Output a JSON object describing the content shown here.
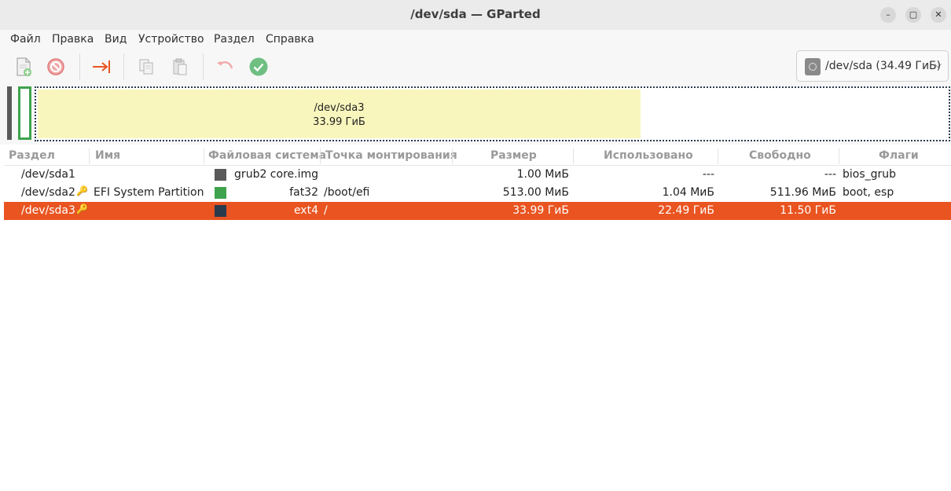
{
  "window": {
    "title": "/dev/sda — GParted",
    "buttons": {
      "minimize": "–",
      "maximize": "▢",
      "close": "✕"
    }
  },
  "menu": [
    "Файл",
    "Правка",
    "Вид",
    "Устройство",
    "Раздел",
    "Справка"
  ],
  "toolbar": {
    "icons": [
      "new-partition-icon",
      "delete-icon",
      "resize-move-icon",
      "copy-icon",
      "paste-icon",
      "undo-icon",
      "apply-icon"
    ],
    "device_label": "/dev/sda (34.49 ГиБ)"
  },
  "diskmap": {
    "selected_name": "/dev/sda3",
    "selected_size": "33.99 ГиБ",
    "used_fraction": 0.66
  },
  "table": {
    "headers": [
      "Раздел",
      "Имя",
      "Файловая система",
      "Точка монтирования",
      "Размер",
      "Использовано",
      "Свободно",
      "Флаги"
    ],
    "rows": [
      {
        "partition": "/dev/sda1",
        "name": "",
        "fs": "grub2 core.img",
        "mount": "",
        "size": "1.00 МиБ",
        "used": "---",
        "free": "---",
        "flags": "bios_grub",
        "color": "#5a5a5a",
        "locked": false
      },
      {
        "partition": "/dev/sda2",
        "name": "EFI System Partition",
        "fs": "fat32",
        "mount": "/boot/efi",
        "size": "513.00 МиБ",
        "used": "1.04 МиБ",
        "free": "511.96 МиБ",
        "flags": "boot, esp",
        "color": "#3fa34d",
        "locked": true
      },
      {
        "partition": "/dev/sda3",
        "name": "",
        "fs": "ext4",
        "mount": "/",
        "size": "33.99 ГиБ",
        "used": "22.49 ГиБ",
        "free": "11.50 ГиБ",
        "flags": "",
        "color": "#2b3a4d",
        "locked": true
      }
    ],
    "selected_row": 2
  },
  "colors": {
    "accent": "#e95420",
    "used_space": "#f8f6bd"
  }
}
